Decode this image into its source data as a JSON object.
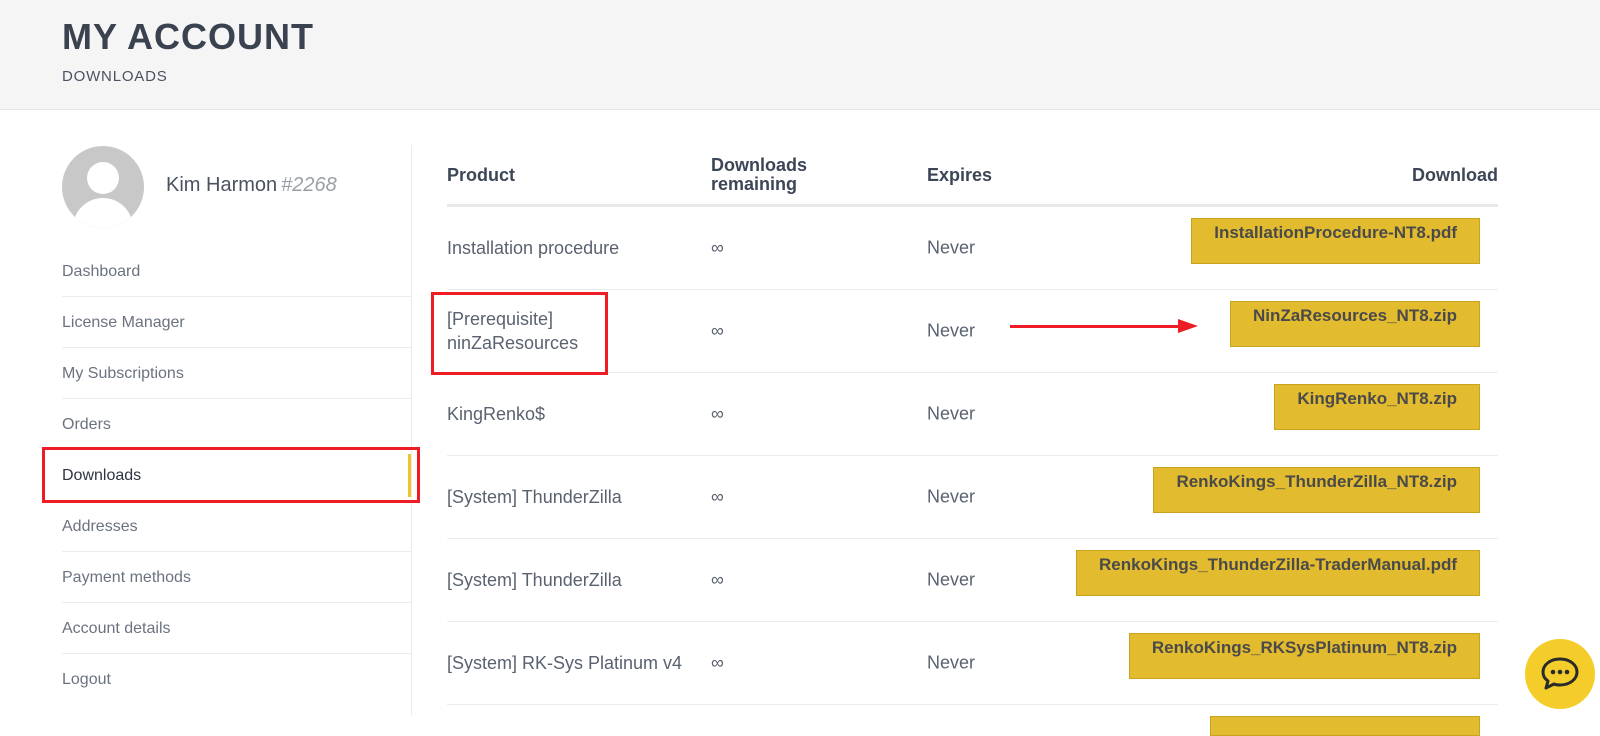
{
  "header": {
    "title": "MY ACCOUNT",
    "subtitle": "DOWNLOADS"
  },
  "user": {
    "name": "Kim Harmon",
    "id": "#2268"
  },
  "sidebar": {
    "items": [
      {
        "label": "Dashboard"
      },
      {
        "label": "License Manager"
      },
      {
        "label": "My Subscriptions"
      },
      {
        "label": "Orders"
      },
      {
        "label": "Downloads",
        "active": true
      },
      {
        "label": "Addresses"
      },
      {
        "label": "Payment methods"
      },
      {
        "label": "Account details"
      },
      {
        "label": "Logout"
      }
    ]
  },
  "table": {
    "headers": {
      "product": "Product",
      "remaining_1": "Downloads",
      "remaining_2": "remaining",
      "expires": "Expires",
      "download": "Download"
    },
    "rows": [
      {
        "product": "Installation procedure",
        "remaining": "∞",
        "expires": "Never",
        "file": "InstallationProcedure-NT8.pdf"
      },
      {
        "product_1": "[Prerequisite]",
        "product_2": "ninZaResources",
        "remaining": "∞",
        "expires": "Never",
        "file": "NinZaResources_NT8.zip"
      },
      {
        "product": "KingRenko$",
        "remaining": "∞",
        "expires": "Never",
        "file": "KingRenko_NT8.zip"
      },
      {
        "product": "[System] ThunderZilla",
        "remaining": "∞",
        "expires": "Never",
        "file": "RenkoKings_ThunderZilla_NT8.zip"
      },
      {
        "product": "[System] ThunderZilla",
        "remaining": "∞",
        "expires": "Never",
        "file": "RenkoKings_ThunderZilla-TraderManual.pdf"
      },
      {
        "product": "[System] RK-Sys Platinum v4",
        "remaining": "∞",
        "expires": "Never",
        "file": "RenkoKings_RKSysPlatinum_NT8.zip"
      }
    ]
  },
  "colors": {
    "accent": "#e2bb2e",
    "annotation": "#ee1c24"
  },
  "icons": {
    "chat": "chat-bubble-icon",
    "avatar": "user-avatar-icon"
  }
}
